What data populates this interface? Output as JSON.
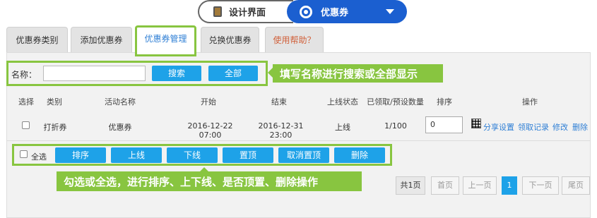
{
  "topbar": {
    "design_label": "设计界面",
    "coupon_label": "优惠券"
  },
  "tabs": [
    {
      "label": "优惠券类别"
    },
    {
      "label": "添加优惠券"
    },
    {
      "label": "优惠券管理"
    },
    {
      "label": "兑换优惠券"
    },
    {
      "label": "使用帮助？"
    }
  ],
  "search": {
    "name_label": "名称：",
    "name_value": "",
    "search_button": "搜索",
    "all_button": "全部",
    "tip": "填写名称进行搜索或全部显示"
  },
  "table": {
    "headers": [
      "选择",
      "类别",
      "活动名称",
      "开始",
      "结束",
      "上线状态",
      "已领取/预设数量",
      "排序",
      "操作"
    ],
    "rows": [
      {
        "category": "打折券",
        "name": "优惠券",
        "start": "2016-12-22 07:00",
        "end": "2016-12-31 23:00",
        "status": "上线",
        "claimed": "1/100",
        "sort": "0",
        "actions": [
          "分享设置",
          "领取记录",
          "修改",
          "删除"
        ]
      }
    ]
  },
  "bulk": {
    "select_all": "全选",
    "buttons": [
      "排序",
      "上线",
      "下线",
      "置顶",
      "取消置顶",
      "删除"
    ],
    "tip": "勾选或全选，进行排序、上下线、是否顶置、删除操作"
  },
  "pagination": {
    "total": "共1页",
    "first": "首页",
    "prev": "上一页",
    "current": "1",
    "next": "下一页",
    "last": "尾页"
  },
  "colors": {
    "accent_green": "#88c540",
    "button_blue": "#1ea2e8",
    "switch_blue": "#1b5fd0"
  }
}
